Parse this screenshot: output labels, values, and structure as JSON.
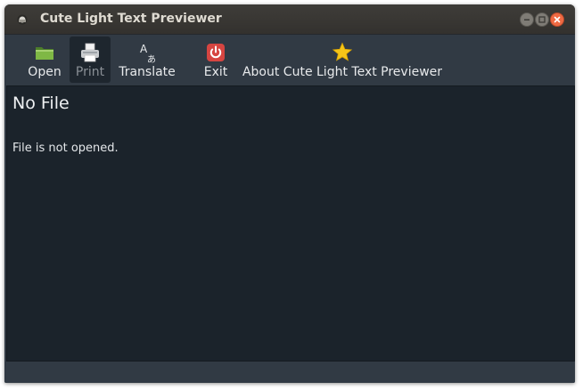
{
  "window": {
    "title": "Cute Light Text Previewer"
  },
  "toolbar": {
    "items": [
      {
        "label": "Open",
        "icon": "folder-icon",
        "state": "normal"
      },
      {
        "label": "Print",
        "icon": "printer-icon",
        "state": "disabled"
      },
      {
        "label": "Translate",
        "icon": "translate-icon",
        "state": "normal",
        "glyph_top": "A",
        "glyph_bottom": "あ"
      },
      {
        "label": "Exit",
        "icon": "power-icon",
        "state": "normal"
      },
      {
        "label": "About Cute Light Text Previewer",
        "icon": "star-icon",
        "state": "normal"
      }
    ]
  },
  "document": {
    "title": "No File",
    "body": "File is not opened."
  },
  "colors": {
    "window_bg": "#313a44",
    "content_bg": "#1b232b",
    "close_button": "#ef6a43",
    "exit_icon": "#d64541",
    "star_icon": "#f5c518",
    "folder_icon": "#6fa83a"
  }
}
